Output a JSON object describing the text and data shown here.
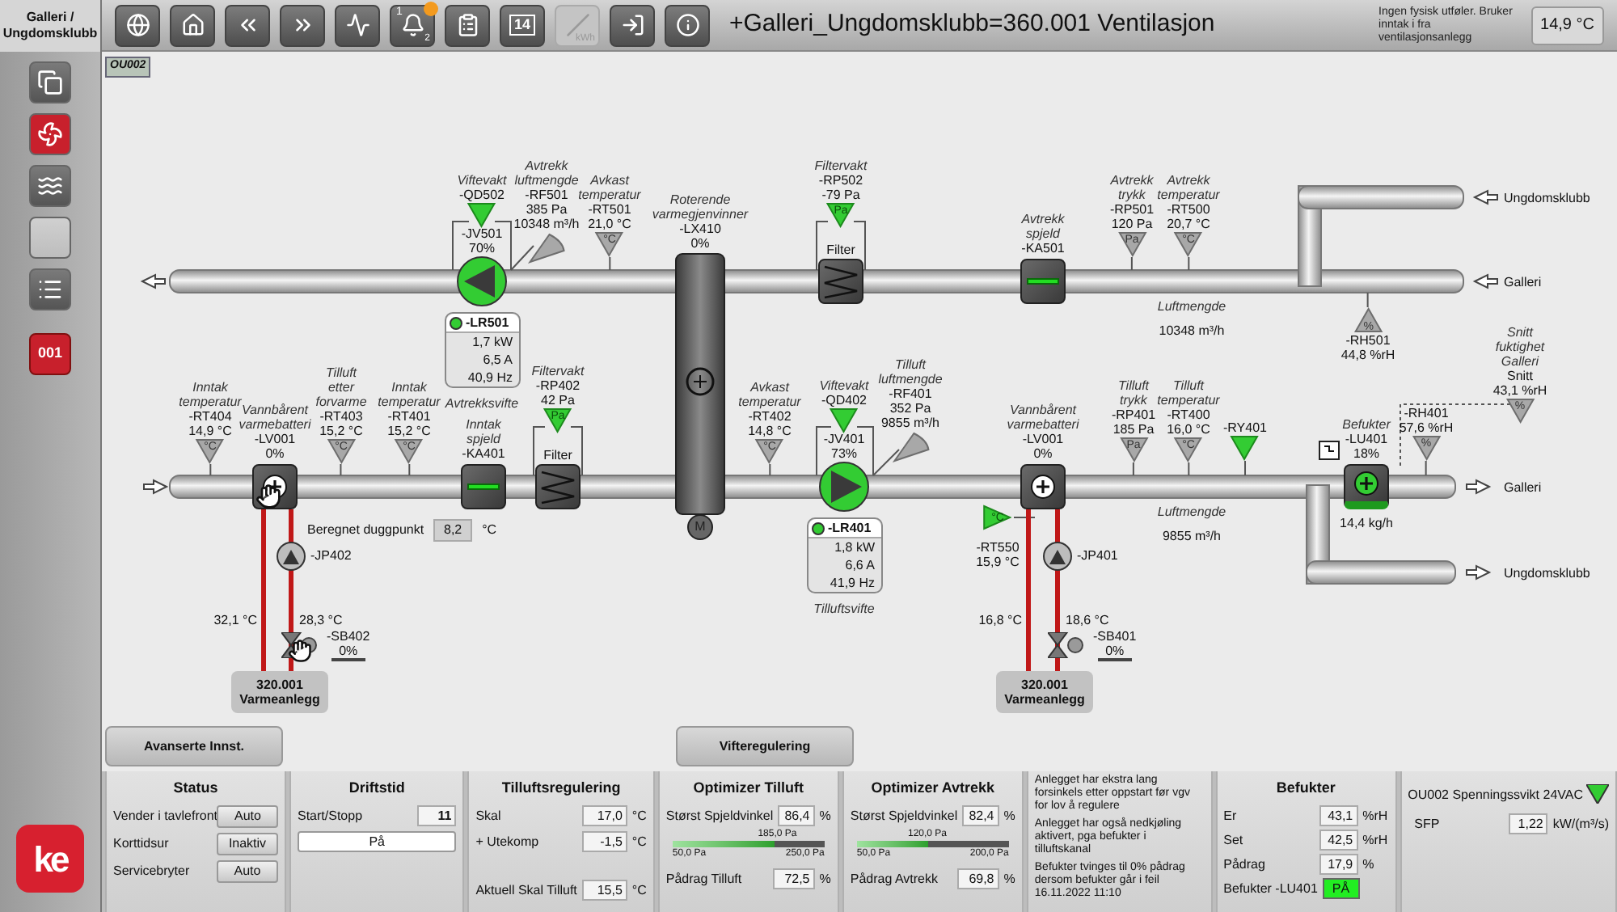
{
  "sidebar": {
    "title": "Galleri / Ungdomsklubb",
    "items": [
      {
        "kind": "windows",
        "selected": false
      },
      {
        "kind": "fan",
        "selected": true
      },
      {
        "kind": "heat",
        "selected": false
      },
      {
        "kind": "blank",
        "selected": false
      },
      {
        "kind": "list",
        "selected": false
      }
    ],
    "system": "001",
    "logo": "ke"
  },
  "toolbar": {
    "buttons": [
      {
        "kind": "globe",
        "disabled": false
      },
      {
        "kind": "home",
        "disabled": false
      },
      {
        "kind": "back",
        "disabled": false
      },
      {
        "kind": "forward",
        "disabled": false
      },
      {
        "kind": "trend",
        "disabled": false
      },
      {
        "kind": "alarms",
        "label": "2",
        "sublabel": "1",
        "alert": true,
        "disabled": false
      },
      {
        "kind": "log",
        "disabled": false
      },
      {
        "kind": "calendar",
        "label": "14",
        "disabled": false
      },
      {
        "kind": "curve",
        "label": "kWh",
        "disabled": true
      },
      {
        "kind": "login",
        "disabled": false
      },
      {
        "kind": "info",
        "disabled": false
      }
    ],
    "title": "+Galleri_Ungdomsklubb=360.001 Ventilasjon",
    "note": "Ingen fysisk utføler. Bruker inntak i fra ventilasjonsanlegg",
    "outdoor_temp": "14,9 °C"
  },
  "diagram": {
    "tag": "OU002",
    "sensors": [
      {
        "kind": "funnel",
        "caption": "Viftevakt",
        "tag": "-QD502",
        "active": true
      },
      {
        "kind": "cone",
        "caption": "Avtrekk luftmengde",
        "tag": "-RF501",
        "values": [
          "385 Pa",
          "10348 m³/h"
        ],
        "active": false
      },
      {
        "kind": "funnel",
        "caption": "Avkast temperatur",
        "tag": "-RT501",
        "values": [
          "21,0 °C"
        ],
        "symbol": "°C",
        "active": false
      },
      {
        "kind": "funnel",
        "caption": "Filtervakt",
        "tag": "-RP502",
        "values": [
          "-79 Pa"
        ],
        "symbol": "Pa",
        "active": true
      },
      {
        "kind": "funnel",
        "caption": "Avtrekk trykk",
        "tag": "-RP501",
        "values": [
          "120 Pa"
        ],
        "symbol": "Pa",
        "active": false
      },
      {
        "kind": "funnel",
        "caption": "Avtrekk temperatur",
        "tag": "-RT500",
        "values": [
          "20,7 °C"
        ],
        "symbol": "°C",
        "active": false
      },
      {
        "kind": "funnel",
        "tag": "-RH501",
        "values": [
          "44,8 %rH"
        ],
        "symbol": "%",
        "active": false
      },
      {
        "kind": "funnel",
        "caption": "Inntak temperatur",
        "tag": "-RT404",
        "values": [
          "14,9 °C"
        ],
        "symbol": "°C",
        "active": false
      },
      {
        "kind": "funnel",
        "caption": "Tilluft etter forvarme",
        "tag": "-RT403",
        "values": [
          "15,2 °C"
        ],
        "symbol": "°C",
        "active": false
      },
      {
        "kind": "funnel",
        "caption": "Inntak temperatur",
        "tag": "-RT401",
        "values": [
          "15,2 °C"
        ],
        "symbol": "°C",
        "active": false
      },
      {
        "kind": "funnel",
        "caption": "Filtervakt",
        "tag": "-RP402",
        "values": [
          "42 Pa"
        ],
        "symbol": "Pa",
        "active": true
      },
      {
        "kind": "funnel",
        "caption": "Avkast temperatur",
        "tag": "-RT402",
        "values": [
          "14,8 °C"
        ],
        "symbol": "°C",
        "active": false
      },
      {
        "kind": "funnel",
        "caption": "Viftevakt",
        "tag": "-QD402",
        "active": true
      },
      {
        "kind": "cone",
        "caption": "Tilluft luftmengde",
        "tag": "-RF401",
        "values": [
          "352 Pa",
          "9855 m³/h"
        ],
        "active": false
      },
      {
        "kind": "funnel",
        "caption": "Tilluft trykk",
        "tag": "-RP401",
        "values": [
          "185 Pa"
        ],
        "symbol": "Pa",
        "active": false
      },
      {
        "kind": "funnel",
        "caption": "Tilluft temperatur",
        "tag": "-RT400",
        "values": [
          "16,0 °C"
        ],
        "symbol": "°C",
        "active": false
      },
      {
        "kind": "funnel",
        "tag": "-RY401",
        "active": true
      },
      {
        "kind": "funnel",
        "tag": "-RH401",
        "values": [
          "57,6 %rH"
        ],
        "symbol": "%",
        "active": false
      },
      {
        "kind": "funnel",
        "caption": "Snitt fuktighet Galleri",
        "tag": "Snitt",
        "values": [
          "43,1 %rH"
        ],
        "symbol": "%",
        "active": false
      },
      {
        "kind": "side",
        "tag": "-RT550",
        "values": [
          "15,9 °C"
        ],
        "symbol": "°C",
        "active": true
      }
    ],
    "fans": [
      {
        "tag": "-JV501",
        "value": "70%",
        "kind": "exhaust",
        "running": true,
        "drive": "-LR501",
        "drive_running": true,
        "readings": [
          "1,7 kW",
          "6,5 A",
          "40,9 Hz"
        ],
        "caption": "Avtrekksvifte"
      },
      {
        "tag": "-JV401",
        "value": "73%",
        "kind": "supply",
        "running": true,
        "drive": "-LR401",
        "drive_running": true,
        "readings": [
          "1,8 kW",
          "6,6 A",
          "41,9 Hz"
        ],
        "caption": "Tilluftsvifte"
      }
    ],
    "filters": [
      {
        "label": "Filter"
      },
      {
        "label": "Filter"
      }
    ],
    "dampers": [
      {
        "caption": "Avtrekk spjeld",
        "tag": "-KA501",
        "open": true
      },
      {
        "caption": "Inntak spjeld",
        "tag": "-KA401",
        "open": true
      }
    ],
    "rotor": {
      "caption": "Roterende varmegjenvinner",
      "tag": "-LX410",
      "value": "0%",
      "motor": "M"
    },
    "coils": [
      {
        "caption": "Vannbårent varmebatteri",
        "tag": "-LV001",
        "value": "0%",
        "manual": true
      },
      {
        "caption": "Vannbårent varmebatteri",
        "tag": "-LV001",
        "value": "0%",
        "manual": false
      }
    ],
    "humidifier": {
      "caption": "Befukter",
      "tag": "-LU401",
      "value": "18%",
      "flow": "14,4 kg/h",
      "running": true
    },
    "dew_point": {
      "label": "Beregnet duggpunkt",
      "value": "8,2",
      "unit": "°C"
    },
    "airflows": [
      {
        "label": "Luftmengde",
        "value": "10348 m³/h"
      },
      {
        "label": "Luftmengde",
        "value": "9855 m³/h"
      }
    ],
    "water_circuits": [
      {
        "pump": "-JP402",
        "pump_running": false,
        "supply_temp": "32,1 °C",
        "return_temp": "28,3 °C",
        "valve": "-SB402",
        "valve_value": "0%",
        "manual": true,
        "plant": "320.001",
        "plant_name": "Varmeanlegg"
      },
      {
        "pump": "-JP401",
        "pump_running": false,
        "supply_temp": "16,8 °C",
        "return_temp": "18,6 °C",
        "valve": "-SB401",
        "valve_value": "0%",
        "manual": false,
        "plant": "320.001",
        "plant_name": "Varmeanlegg"
      }
    ],
    "duct_ends": [
      {
        "label": "Ungdomsklubb",
        "kind": "return"
      },
      {
        "label": "Galleri",
        "kind": "return"
      },
      {
        "label": "Galleri",
        "kind": "supply"
      },
      {
        "label": "Ungdomsklubb",
        "kind": "supply"
      }
    ],
    "buttons": [
      "Avanserte Innst.",
      "Vifteregulering"
    ]
  },
  "panels": {
    "status": {
      "title": "Status",
      "rows": [
        {
          "label": "Vender i tavlefront",
          "value": "Auto"
        },
        {
          "label": "Korttidsur",
          "value": "Inaktiv"
        },
        {
          "label": "Servicebryter",
          "value": "Auto"
        }
      ]
    },
    "runtime": {
      "title": "Driftstid",
      "label": "Start/Stopp",
      "value": "11",
      "button": "På"
    },
    "supply_control": {
      "title": "Tilluftsregulering",
      "rows": [
        {
          "label": "Skal",
          "value": "17,0",
          "unit": "°C"
        },
        {
          "label": "+ Utekomp",
          "value": "-1,5",
          "unit": "°C"
        },
        {
          "label": "Aktuell Skal Tilluft",
          "value": "15,5",
          "unit": "°C"
        }
      ]
    },
    "optimizers": [
      {
        "title": "Optimizer Tilluft",
        "label": "Størst Spjeldvinkel",
        "value": "86,4",
        "unit": "%",
        "marker": "185,0 Pa",
        "min": "50,0 Pa",
        "max": "250,0 Pa",
        "level": 0.675,
        "output_label": "Pådrag Tilluft",
        "output": "72,5",
        "output_unit": "%"
      },
      {
        "title": "Optimizer Avtrekk",
        "label": "Størst Spjeldvinkel",
        "value": "82,4",
        "unit": "%",
        "marker": "120,0 Pa",
        "min": "50,0 Pa",
        "max": "200,0 Pa",
        "level": 0.467,
        "output_label": "Pådrag Avtrekk",
        "output": "69,8",
        "output_unit": "%"
      }
    ],
    "notes": [
      "Anlegget har ekstra lang forsinkels etter oppstart før vgv for lov å regulere",
      "Anlegget har også nedkjøling aktivert, pga befukter i tilluftskanal",
      "Befukter tvinges til 0% pådrag dersom befukter går i feil 16.11.2022 11:10"
    ],
    "humidifier": {
      "title": "Befukter",
      "rows": [
        {
          "label": "Er",
          "value": "43,1",
          "unit": "%rH"
        },
        {
          "label": "Set",
          "value": "42,5",
          "unit": "%rH"
        },
        {
          "label": "Pådrag",
          "value": "17,9",
          "unit": "%"
        }
      ],
      "switch_label": "Befukter -LU401",
      "switch_value": "PÅ",
      "switch_on": true
    },
    "alarm": {
      "text": "OU002 Spenningssvikt 24VAC",
      "ok": true,
      "label": "SFP",
      "value": "1,22",
      "unit": "kW/(m³/s)"
    }
  }
}
